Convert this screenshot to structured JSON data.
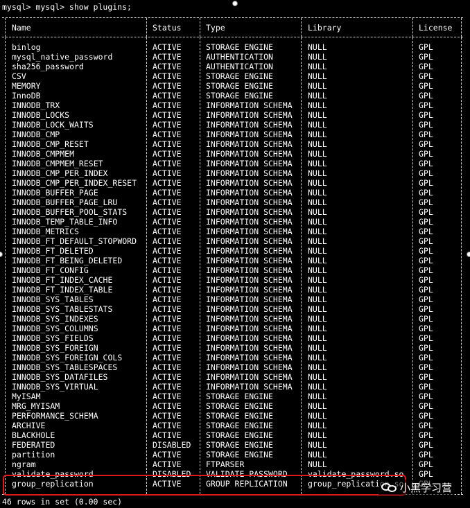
{
  "terminal": {
    "prompt_line": "mysql> mysql> show plugins;",
    "footer": "46 rows in set (0.00 sec)"
  },
  "table": {
    "headers": [
      "Name",
      "Status",
      "Type",
      "Library",
      "License"
    ],
    "rows": [
      [
        "binlog",
        "ACTIVE",
        "STORAGE ENGINE",
        "NULL",
        "GPL"
      ],
      [
        "mysql_native_password",
        "ACTIVE",
        "AUTHENTICATION",
        "NULL",
        "GPL"
      ],
      [
        "sha256_password",
        "ACTIVE",
        "AUTHENTICATION",
        "NULL",
        "GPL"
      ],
      [
        "CSV",
        "ACTIVE",
        "STORAGE ENGINE",
        "NULL",
        "GPL"
      ],
      [
        "MEMORY",
        "ACTIVE",
        "STORAGE ENGINE",
        "NULL",
        "GPL"
      ],
      [
        "InnoDB",
        "ACTIVE",
        "STORAGE ENGINE",
        "NULL",
        "GPL"
      ],
      [
        "INNODB_TRX",
        "ACTIVE",
        "INFORMATION SCHEMA",
        "NULL",
        "GPL"
      ],
      [
        "INNODB_LOCKS",
        "ACTIVE",
        "INFORMATION SCHEMA",
        "NULL",
        "GPL"
      ],
      [
        "INNODB_LOCK_WAITS",
        "ACTIVE",
        "INFORMATION SCHEMA",
        "NULL",
        "GPL"
      ],
      [
        "INNODB_CMP",
        "ACTIVE",
        "INFORMATION SCHEMA",
        "NULL",
        "GPL"
      ],
      [
        "INNODB_CMP_RESET",
        "ACTIVE",
        "INFORMATION SCHEMA",
        "NULL",
        "GPL"
      ],
      [
        "INNODB_CMPMEM",
        "ACTIVE",
        "INFORMATION SCHEMA",
        "NULL",
        "GPL"
      ],
      [
        "INNODB_CMPMEM_RESET",
        "ACTIVE",
        "INFORMATION SCHEMA",
        "NULL",
        "GPL"
      ],
      [
        "INNODB_CMP_PER_INDEX",
        "ACTIVE",
        "INFORMATION SCHEMA",
        "NULL",
        "GPL"
      ],
      [
        "INNODB_CMP_PER_INDEX_RESET",
        "ACTIVE",
        "INFORMATION SCHEMA",
        "NULL",
        "GPL"
      ],
      [
        "INNODB_BUFFER_PAGE",
        "ACTIVE",
        "INFORMATION SCHEMA",
        "NULL",
        "GPL"
      ],
      [
        "INNODB_BUFFER_PAGE_LRU",
        "ACTIVE",
        "INFORMATION SCHEMA",
        "NULL",
        "GPL"
      ],
      [
        "INNODB_BUFFER_POOL_STATS",
        "ACTIVE",
        "INFORMATION SCHEMA",
        "NULL",
        "GPL"
      ],
      [
        "INNODB_TEMP_TABLE_INFO",
        "ACTIVE",
        "INFORMATION SCHEMA",
        "NULL",
        "GPL"
      ],
      [
        "INNODB_METRICS",
        "ACTIVE",
        "INFORMATION SCHEMA",
        "NULL",
        "GPL"
      ],
      [
        "INNODB_FT_DEFAULT_STOPWORD",
        "ACTIVE",
        "INFORMATION SCHEMA",
        "NULL",
        "GPL"
      ],
      [
        "INNODB_FT_DELETED",
        "ACTIVE",
        "INFORMATION SCHEMA",
        "NULL",
        "GPL"
      ],
      [
        "INNODB_FT_BEING_DELETED",
        "ACTIVE",
        "INFORMATION SCHEMA",
        "NULL",
        "GPL"
      ],
      [
        "INNODB_FT_CONFIG",
        "ACTIVE",
        "INFORMATION SCHEMA",
        "NULL",
        "GPL"
      ],
      [
        "INNODB_FT_INDEX_CACHE",
        "ACTIVE",
        "INFORMATION SCHEMA",
        "NULL",
        "GPL"
      ],
      [
        "INNODB_FT_INDEX_TABLE",
        "ACTIVE",
        "INFORMATION SCHEMA",
        "NULL",
        "GPL"
      ],
      [
        "INNODB_SYS_TABLES",
        "ACTIVE",
        "INFORMATION SCHEMA",
        "NULL",
        "GPL"
      ],
      [
        "INNODB_SYS_TABLESTATS",
        "ACTIVE",
        "INFORMATION SCHEMA",
        "NULL",
        "GPL"
      ],
      [
        "INNODB_SYS_INDEXES",
        "ACTIVE",
        "INFORMATION SCHEMA",
        "NULL",
        "GPL"
      ],
      [
        "INNODB_SYS_COLUMNS",
        "ACTIVE",
        "INFORMATION SCHEMA",
        "NULL",
        "GPL"
      ],
      [
        "INNODB_SYS_FIELDS",
        "ACTIVE",
        "INFORMATION SCHEMA",
        "NULL",
        "GPL"
      ],
      [
        "INNODB_SYS_FOREIGN",
        "ACTIVE",
        "INFORMATION SCHEMA",
        "NULL",
        "GPL"
      ],
      [
        "INNODB_SYS_FOREIGN_COLS",
        "ACTIVE",
        "INFORMATION SCHEMA",
        "NULL",
        "GPL"
      ],
      [
        "INNODB_SYS_TABLESPACES",
        "ACTIVE",
        "INFORMATION SCHEMA",
        "NULL",
        "GPL"
      ],
      [
        "INNODB_SYS_DATAFILES",
        "ACTIVE",
        "INFORMATION SCHEMA",
        "NULL",
        "GPL"
      ],
      [
        "INNODB_SYS_VIRTUAL",
        "ACTIVE",
        "INFORMATION SCHEMA",
        "NULL",
        "GPL"
      ],
      [
        "MyISAM",
        "ACTIVE",
        "STORAGE ENGINE",
        "NULL",
        "GPL"
      ],
      [
        "MRG_MYISAM",
        "ACTIVE",
        "STORAGE ENGINE",
        "NULL",
        "GPL"
      ],
      [
        "PERFORMANCE_SCHEMA",
        "ACTIVE",
        "STORAGE ENGINE",
        "NULL",
        "GPL"
      ],
      [
        "ARCHIVE",
        "ACTIVE",
        "STORAGE ENGINE",
        "NULL",
        "GPL"
      ],
      [
        "BLACKHOLE",
        "ACTIVE",
        "STORAGE ENGINE",
        "NULL",
        "GPL"
      ],
      [
        "FEDERATED",
        "DISABLED",
        "STORAGE ENGINE",
        "NULL",
        "GPL"
      ],
      [
        "partition",
        "ACTIVE",
        "STORAGE ENGINE",
        "NULL",
        "GPL"
      ],
      [
        "ngram",
        "ACTIVE",
        "FTPARSER",
        "NULL",
        "GPL"
      ],
      [
        "validate_password",
        "DISABLED",
        "VALIDATE PASSWORD",
        "validate_password.so",
        "GPL"
      ],
      [
        "group_replication",
        "ACTIVE",
        "GROUP REPLICATION",
        "group_replication.so",
        "GPL"
      ]
    ]
  },
  "watermark": {
    "text": "小黑学习营",
    "icon": "wechat-icon"
  },
  "colors": {
    "background": "#000000",
    "text": "#ffffff",
    "highlight": "#e01a1a"
  }
}
